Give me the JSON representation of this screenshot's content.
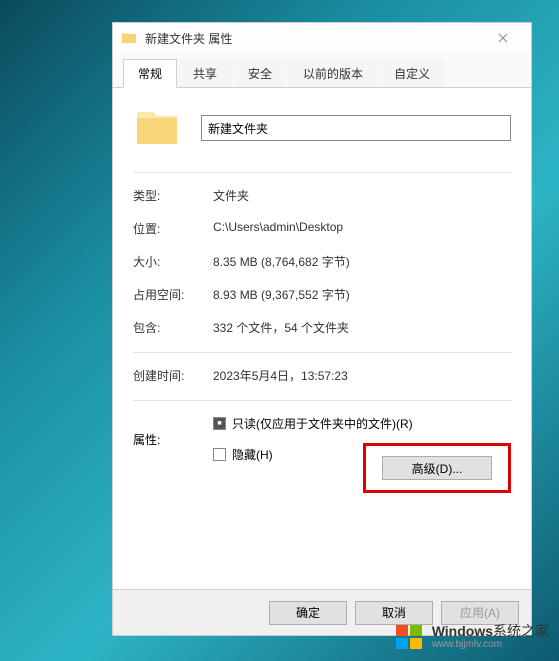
{
  "titlebar": {
    "title": "新建文件夹 属性"
  },
  "tabs": {
    "items": [
      {
        "label": "常规"
      },
      {
        "label": "共享"
      },
      {
        "label": "安全"
      },
      {
        "label": "以前的版本"
      },
      {
        "label": "自定义"
      }
    ]
  },
  "folder": {
    "name": "新建文件夹"
  },
  "info": {
    "type_label": "类型:",
    "type_value": "文件夹",
    "location_label": "位置:",
    "location_value": "C:\\Users\\admin\\Desktop",
    "size_label": "大小:",
    "size_value": "8.35 MB (8,764,682 字节)",
    "disk_label": "占用空间:",
    "disk_value": "8.93 MB (9,367,552 字节)",
    "contains_label": "包含:",
    "contains_value": "332 个文件，54 个文件夹",
    "created_label": "创建时间:",
    "created_value": "2023年5月4日，13:57:23"
  },
  "attributes": {
    "label": "属性:",
    "readonly_label": "只读(仅应用于文件夹中的文件)(R)",
    "hidden_label": "隐藏(H)",
    "advanced_label": "高级(D)..."
  },
  "footer": {
    "ok": "确定",
    "cancel": "取消",
    "apply": "应用(A)"
  },
  "watermark": {
    "brand": "Windows",
    "suffix": "系统之家",
    "url": "www.bjjmlv.com"
  }
}
